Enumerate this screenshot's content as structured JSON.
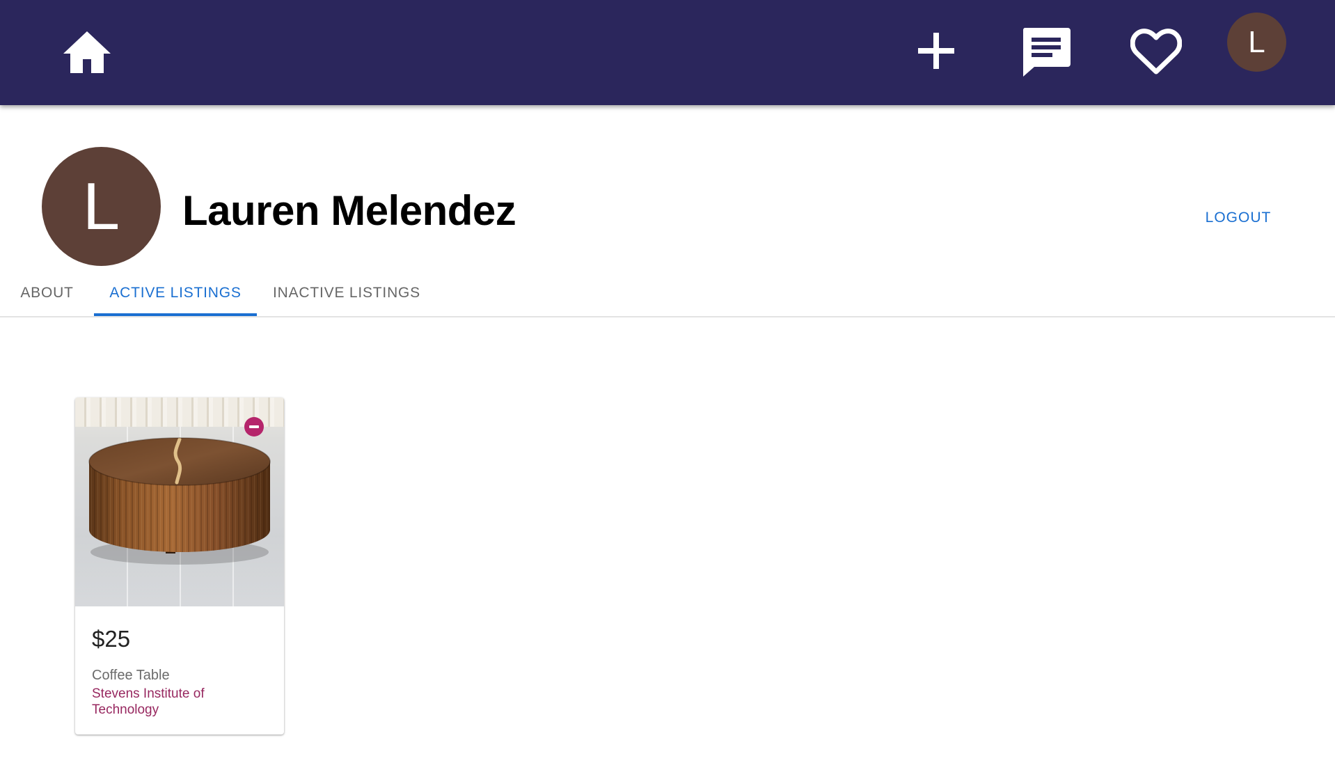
{
  "topbar": {
    "home_icon": "home-icon",
    "add_icon": "plus-icon",
    "messages_icon": "chat-icon",
    "favorites_icon": "heart-icon",
    "avatar_initial": "L",
    "background_color": "#2b265c"
  },
  "profile": {
    "avatar_initial": "L",
    "avatar_color": "#5d4037",
    "name": "Lauren Melendez",
    "logout_label": "LOGOUT"
  },
  "tabs": {
    "items": [
      {
        "label": "ABOUT"
      },
      {
        "label": "ACTIVE LISTINGS"
      },
      {
        "label": "INACTIVE LISTINGS"
      }
    ],
    "active_index": 1,
    "accent_color": "#1a6fd1"
  },
  "listings": [
    {
      "price": "$25",
      "title": "Coffee Table",
      "location": "Stevens Institute of Technology",
      "remove_icon": "remove-circle-icon"
    }
  ]
}
